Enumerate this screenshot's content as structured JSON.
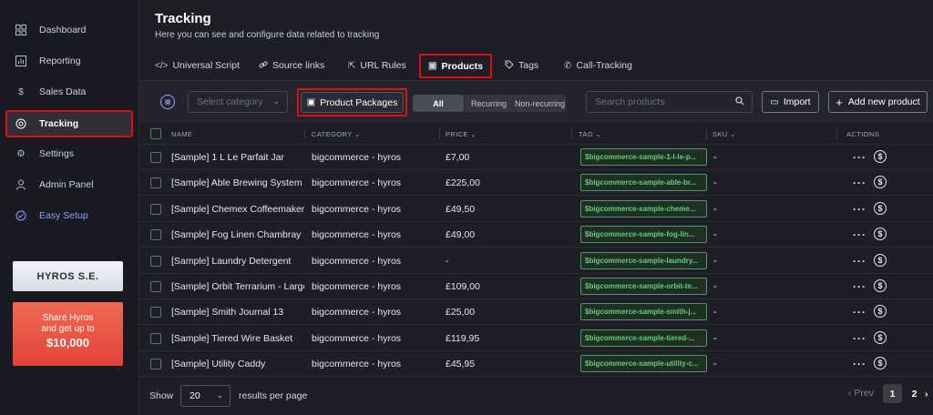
{
  "sidebar": {
    "items": [
      {
        "label": "Dashboard",
        "icon": "grid-icon"
      },
      {
        "label": "Reporting",
        "icon": "chart-icon"
      },
      {
        "label": "Sales Data",
        "icon": "dollar-icon"
      },
      {
        "label": "Tracking",
        "icon": "target-icon"
      },
      {
        "label": "Settings",
        "icon": "gear-icon"
      },
      {
        "label": "Admin Panel",
        "icon": "user-icon"
      },
      {
        "label": "Easy Setup",
        "icon": "check-circle-icon"
      }
    ],
    "brand": "HYROS S.E.",
    "promo": {
      "line1": "Share Hyros",
      "line2": "and get up to",
      "amount": "$10,000"
    }
  },
  "header": {
    "title": "Tracking",
    "subtitle": "Here you can see and configure data related to tracking"
  },
  "tabs": [
    {
      "label": "Universal Script",
      "icon": "</>"
    },
    {
      "label": "Source links",
      "icon": "🔗"
    },
    {
      "label": "URL Rules",
      "icon": "⇱"
    },
    {
      "label": "Products",
      "icon": "▣"
    },
    {
      "label": "Tags",
      "icon": "⌂"
    },
    {
      "label": "Call-Tracking",
      "icon": "✆"
    }
  ],
  "toolbar": {
    "category_placeholder": "Select category",
    "packages_label": "Product Packages",
    "segments": [
      "All",
      "Recurring",
      "Non-recurring"
    ],
    "search_placeholder": "Search products",
    "import_label": "Import",
    "add_label": "Add new product"
  },
  "table": {
    "columns": [
      "NAME",
      "CATEGORY",
      "PRICE",
      "TAG",
      "SKU",
      "ACTIONS"
    ],
    "rows": [
      {
        "name": "[Sample] 1 L Le Parfait Jar",
        "category": "bigcommerce - hyros",
        "price": "£7,00",
        "tag": "$bigcommerce-sample-1-l-le-p...",
        "sku": "-"
      },
      {
        "name": "[Sample] Able Brewing System",
        "category": "bigcommerce - hyros",
        "price": "£225,00",
        "tag": "$bigcommerce-sample-able-br...",
        "sku": "-"
      },
      {
        "name": "[Sample] Chemex Coffeemaker...",
        "category": "bigcommerce - hyros",
        "price": "£49,50",
        "tag": "$bigcommerce-sample-cheme...",
        "sku": "-"
      },
      {
        "name": "[Sample] Fog Linen Chambray ...",
        "category": "bigcommerce - hyros",
        "price": "£49,00",
        "tag": "$bigcommerce-sample-fog-lin...",
        "sku": "-"
      },
      {
        "name": "[Sample] Laundry Detergent",
        "category": "bigcommerce - hyros",
        "price": "-",
        "tag": "$bigcommerce-sample-laundry...",
        "sku": "-"
      },
      {
        "name": "[Sample] Orbit Terrarium - Large",
        "category": "bigcommerce - hyros",
        "price": "£109,00",
        "tag": "$bigcommerce-sample-orbit-te...",
        "sku": "-"
      },
      {
        "name": "[Sample] Smith Journal 13",
        "category": "bigcommerce - hyros",
        "price": "£25,00",
        "tag": "$bigcommerce-sample-smith-j...",
        "sku": "-"
      },
      {
        "name": "[Sample] Tiered Wire Basket",
        "category": "bigcommerce - hyros",
        "price": "£119,95",
        "tag": "$bigcommerce-sample-tiered-...",
        "sku": "-"
      },
      {
        "name": "[Sample] Utility Caddy",
        "category": "bigcommerce - hyros",
        "price": "£45,95",
        "tag": "$bigcommerce-sample-utility-c...",
        "sku": "-"
      }
    ]
  },
  "footer": {
    "show_label": "Show",
    "per_page": "20",
    "rpp_label": "results per page",
    "prev_label": "Prev",
    "pages": [
      "1",
      "2"
    ],
    "current_page": "1"
  }
}
